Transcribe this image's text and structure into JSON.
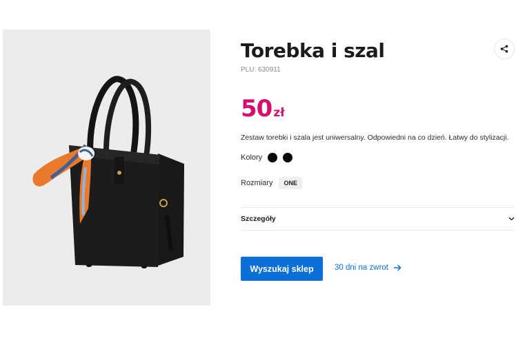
{
  "product": {
    "title": "Torebka i szal",
    "plu": "PLU: 630911",
    "price": "50",
    "currency": "zł",
    "description": "Zestaw torebki i szala jest uniwersalny. Odpowiedni na co dzień. Łatwy do stylizacji.",
    "image_alt": "Torebka i szal"
  },
  "colors": {
    "label": "Kolory",
    "swatches": [
      {
        "name": "black",
        "hex": "#0a0a0a"
      },
      {
        "name": "black",
        "hex": "#0a0a0a"
      }
    ]
  },
  "sizes": {
    "label": "Rozmiary",
    "options": [
      "ONE"
    ]
  },
  "details": {
    "label": "Szczegóły"
  },
  "actions": {
    "find_store": "Wyszukaj sklep",
    "returns": "30 dni na zwrot"
  },
  "theme": {
    "price_color": "#d6106f",
    "accent": "#0b6fd8"
  },
  "icons": {
    "share": "share-icon",
    "chevron": "chevron-down-icon",
    "arrow": "arrow-right-icon"
  }
}
